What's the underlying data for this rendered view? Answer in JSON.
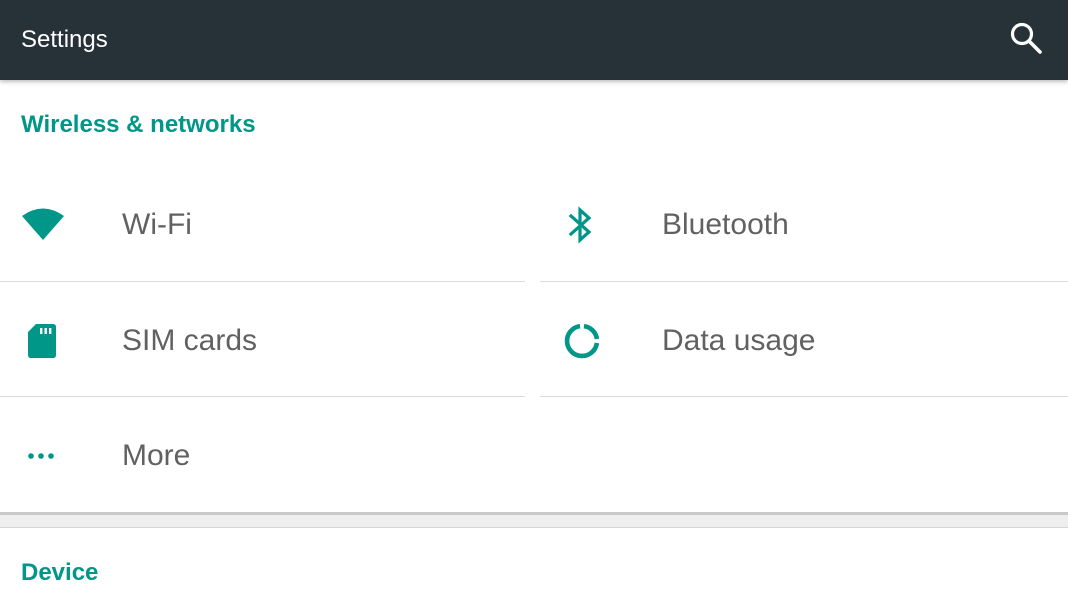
{
  "toolbar": {
    "title": "Settings",
    "search_icon": "search-icon"
  },
  "colors": {
    "toolbar_bg": "#263238",
    "accent": "#009688",
    "label": "#616161"
  },
  "sections": [
    {
      "header": "Wireless & networks",
      "items": [
        {
          "label": "Wi-Fi",
          "icon": "wifi-icon"
        },
        {
          "label": "Bluetooth",
          "icon": "bluetooth-icon"
        },
        {
          "label": "SIM cards",
          "icon": "sim-card-icon"
        },
        {
          "label": "Data usage",
          "icon": "data-usage-icon"
        },
        {
          "label": "More",
          "icon": "more-horiz-icon"
        }
      ]
    },
    {
      "header": "Device",
      "items": []
    }
  ]
}
